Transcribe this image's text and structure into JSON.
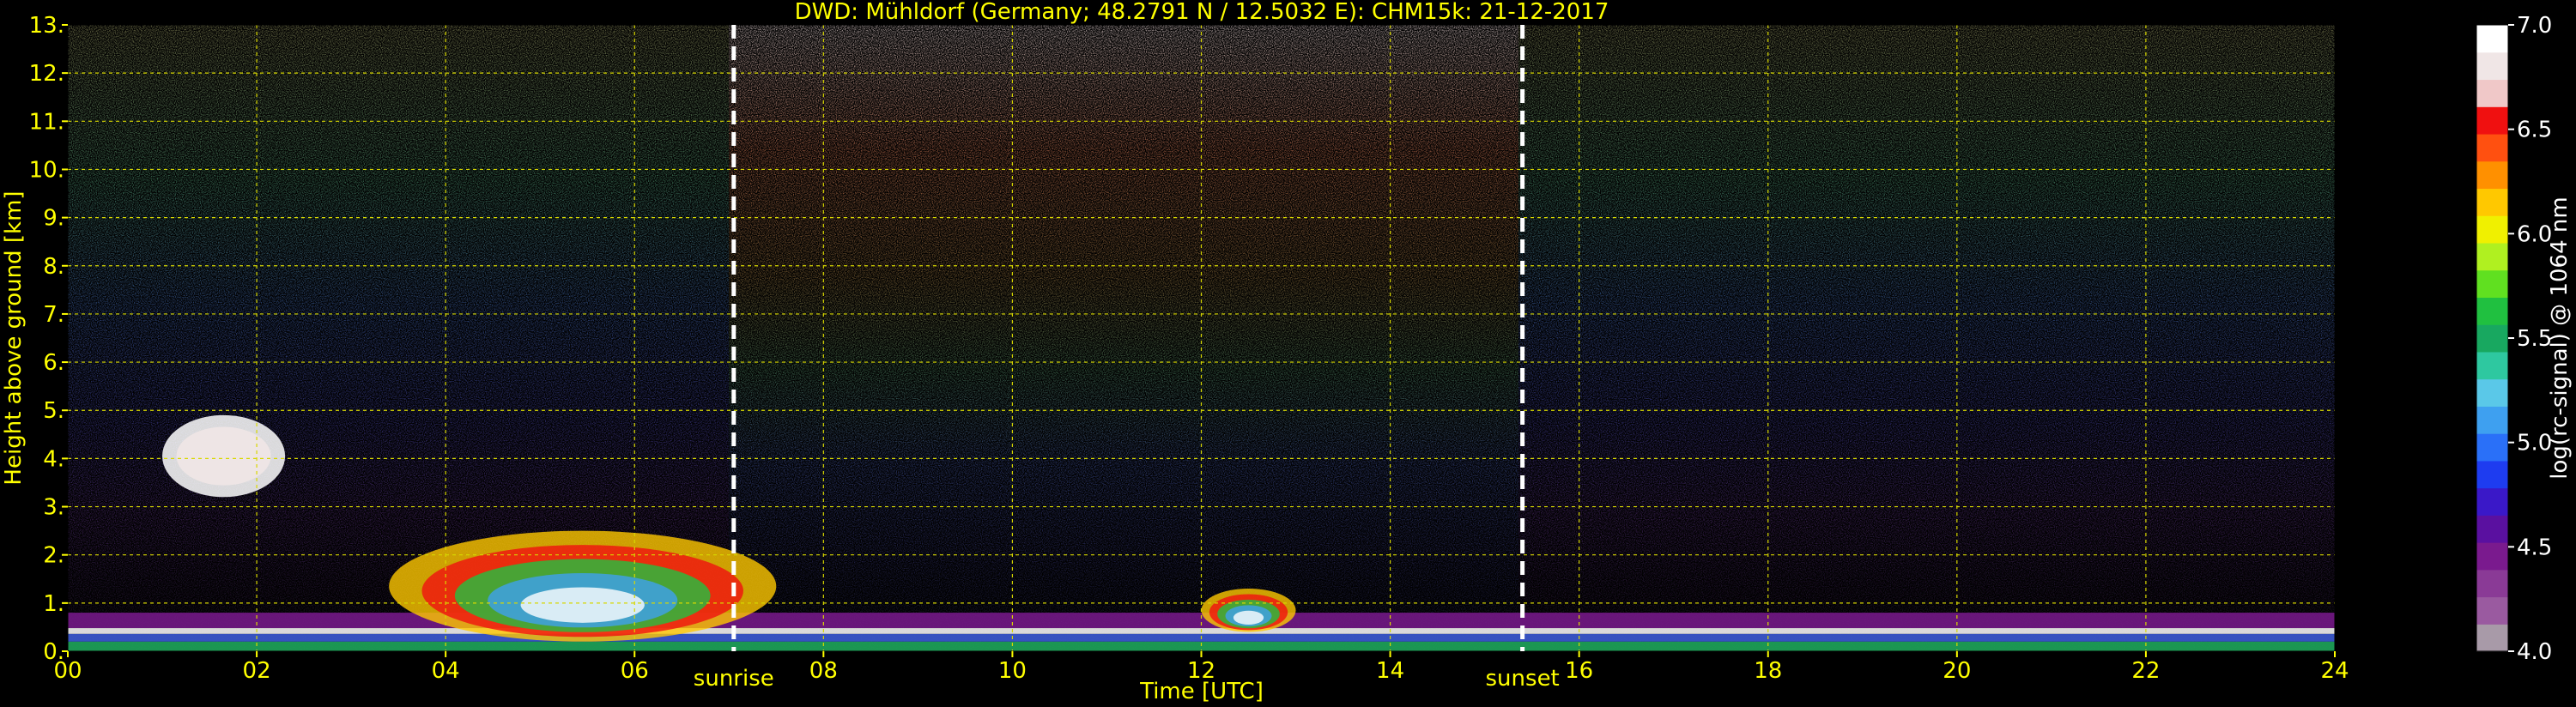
{
  "chart_data": {
    "type": "heatmap",
    "title": "DWD: Mühldorf (Germany; 48.2791 N / 12.5032 E):    CHM15k: 21-12-2017",
    "xlabel": "Time [UTC]",
    "ylabel": "Height above ground [km]",
    "xlim": [
      0,
      24
    ],
    "ylim": [
      0,
      13
    ],
    "x_ticks": [
      "00",
      "02",
      "04",
      "06",
      "08",
      "10",
      "12",
      "14",
      "16",
      "18",
      "20",
      "22",
      "24"
    ],
    "y_ticks": [
      "0.",
      "1.",
      "2.",
      "3.",
      "4.",
      "5.",
      "6.",
      "7.",
      "8.",
      "9.",
      "10.",
      "11.",
      "12.",
      "13."
    ],
    "grid": true,
    "colorbar": {
      "label": "log(rc-signal) @ 1064 nm",
      "range": [
        4.0,
        7.0
      ],
      "ticks": [
        "4.0",
        "4.5",
        "5.0",
        "5.5",
        "6.0",
        "6.5",
        "7.0"
      ],
      "colors": [
        "#a89aa8",
        "#9a5aa0",
        "#8a3a96",
        "#7a1a8e",
        "#5a10a0",
        "#3a18c8",
        "#1e3cf0",
        "#2a70f8",
        "#3ea0f0",
        "#5ac8e8",
        "#2ec8a0",
        "#18a860",
        "#20c040",
        "#60e020",
        "#b0f020",
        "#f0f000",
        "#ffc800",
        "#ff9000",
        "#ff5010",
        "#f01010",
        "#f0c8c8",
        "#f0e6e6",
        "#ffffff"
      ]
    },
    "markers": [
      {
        "name": "sunrise",
        "x": 7.05
      },
      {
        "name": "sunset",
        "x": 15.4
      }
    ],
    "features": [
      {
        "kind": "cloud",
        "x": [
          1.0,
          2.3
        ],
        "y": [
          3.2,
          4.9
        ]
      },
      {
        "kind": "boundary_layer",
        "x": [
          0.0,
          24.0
        ],
        "y": [
          0.0,
          0.8
        ]
      },
      {
        "kind": "low_cloud",
        "x": [
          3.4,
          7.5
        ],
        "y": [
          0.2,
          2.5
        ]
      },
      {
        "kind": "low_cloud",
        "x": [
          12.0,
          13.0
        ],
        "y": [
          0.4,
          1.3
        ]
      }
    ],
    "colors": {
      "text": "#ffff00",
      "grid": "#d8d800",
      "marker": "#ffffff",
      "background": "#000000"
    }
  }
}
